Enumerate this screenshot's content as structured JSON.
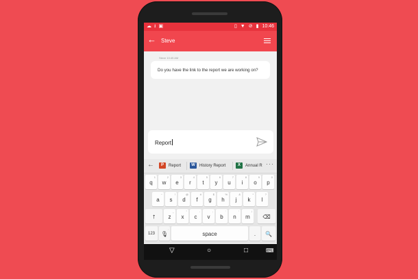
{
  "status": {
    "time": "10:46"
  },
  "appbar": {
    "contact": "Steve"
  },
  "message": {
    "meta": "Steve 10:45 AM",
    "text": "Do you have the link to the report we are working on?"
  },
  "composer": {
    "value": "Report"
  },
  "suggestions": [
    {
      "label": "Report",
      "app": "P",
      "color": "#d24726"
    },
    {
      "label": "History Report",
      "app": "W",
      "color": "#2b579a"
    },
    {
      "label": "Annual R",
      "app": "X",
      "color": "#217346"
    }
  ],
  "suggest_more": "···",
  "keyboard": {
    "row1": [
      {
        "k": "q",
        "h": "1"
      },
      {
        "k": "w",
        "h": "2"
      },
      {
        "k": "e",
        "h": "3"
      },
      {
        "k": "r",
        "h": "4"
      },
      {
        "k": "t",
        "h": "5"
      },
      {
        "k": "y",
        "h": "6"
      },
      {
        "k": "u",
        "h": "7"
      },
      {
        "k": "i",
        "h": "8"
      },
      {
        "k": "o",
        "h": "9"
      },
      {
        "k": "p",
        "h": "0"
      }
    ],
    "row2": [
      {
        "k": "a",
        "h": "~"
      },
      {
        "k": "s",
        "h": "!"
      },
      {
        "k": "d",
        "h": "@"
      },
      {
        "k": "f",
        "h": "#"
      },
      {
        "k": "g",
        "h": "$"
      },
      {
        "k": "h",
        "h": "%"
      },
      {
        "k": "j",
        "h": "&"
      },
      {
        "k": "k",
        "h": "*"
      },
      {
        "k": "l",
        "h": "?"
      }
    ],
    "row3": [
      {
        "k": "z",
        "h": "_"
      },
      {
        "k": "x",
        "h": "\""
      },
      {
        "k": "c",
        "h": ":"
      },
      {
        "k": "v",
        "h": ";"
      },
      {
        "k": "b",
        "h": "'"
      },
      {
        "k": "n",
        "h": "’"
      },
      {
        "k": "m",
        "h": "/"
      }
    ],
    "num_label": "123",
    "comma": ",",
    "space_label": "space",
    "period": "."
  }
}
